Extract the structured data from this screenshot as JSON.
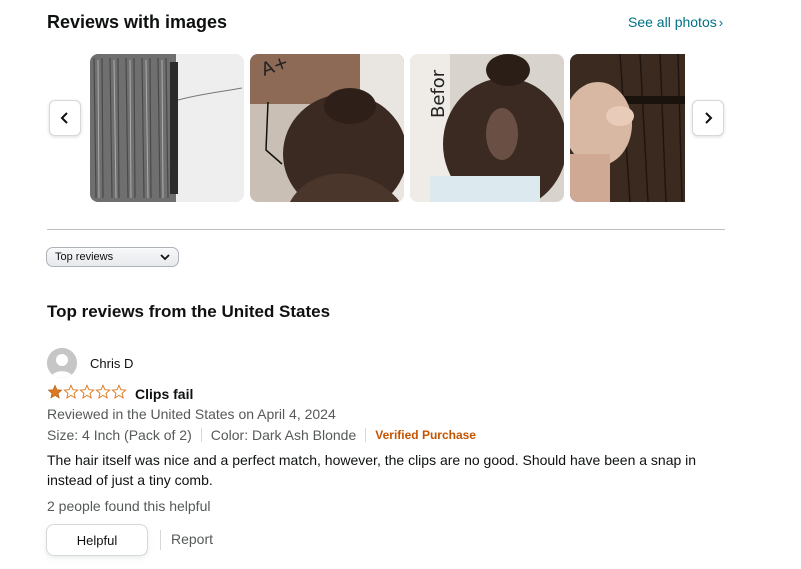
{
  "images_section": {
    "title": "Reviews with images",
    "see_all_label": "See all photos",
    "thumbnails": [
      {
        "alt": "gray hair extension clip"
      },
      {
        "alt": "after photo of hair bun"
      },
      {
        "alt": "before photo of hair bun"
      },
      {
        "alt": "hand holding dark hair extension"
      }
    ]
  },
  "sort": {
    "selected": "Top reviews"
  },
  "reviews_section": {
    "title": "Top reviews from the United States"
  },
  "review": {
    "author": "Chris D",
    "rating": 1,
    "rating_max": 5,
    "title": "Clips fail",
    "date_line": "Reviewed in the United States on April 4, 2024",
    "size": "Size: 4 Inch (Pack of 2)",
    "color": "Color: Dark Ash Blonde",
    "verified": "Verified Purchase",
    "body": "The hair itself was nice and a perfect match, however, the clips are no good. Should have been a snap in instead of just a tiny comb.",
    "helpful_count": "2 people found this helpful",
    "helpful_label": "Helpful",
    "report_label": "Report"
  },
  "colors": {
    "link": "#007185",
    "star": "#de7921",
    "verified": "#c45500",
    "muted": "#565959"
  }
}
